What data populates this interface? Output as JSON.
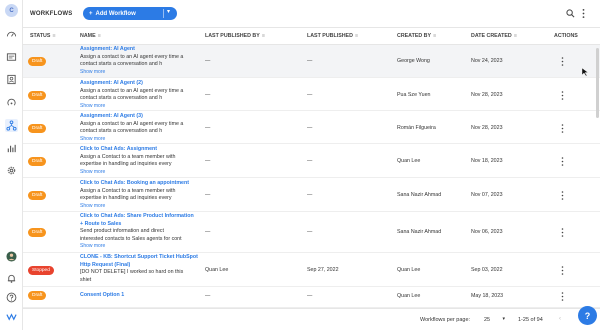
{
  "sidebar": {
    "avatar_initial": "C"
  },
  "header": {
    "title": "WORKFLOWS",
    "add_button": "Add Workflow"
  },
  "table": {
    "columns": [
      "STATUS",
      "NAME",
      "LAST PUBLISHED BY",
      "LAST PUBLISHED",
      "CREATED BY",
      "DATE CREATED",
      "ACTIONS"
    ],
    "rows": [
      {
        "status": "Draft",
        "title": "Assignment: AI Agent",
        "desc": [
          "Assign a contact to an AI agent every time a",
          "contact starts a conversation and h"
        ],
        "more": "Show more",
        "published_by": "—",
        "published": "—",
        "created_by": "George Wong",
        "date_created": "Nov 24, 2023"
      },
      {
        "status": "Draft",
        "title": "Assignment: AI Agent (2)",
        "desc": [
          "Assign a contact to an AI agent every time a",
          "contact starts a conversation and h"
        ],
        "more": "Show more",
        "published_by": "—",
        "published": "—",
        "created_by": "Pua Sze Yuen",
        "date_created": "Nov 28, 2023"
      },
      {
        "status": "Draft",
        "title": "Assignment: AI Agent (3)",
        "desc": [
          "Assign a contact to an AI agent every time a",
          "contact starts a conversation and h"
        ],
        "more": "Show more",
        "published_by": "—",
        "published": "—",
        "created_by": "Román Filgueira",
        "date_created": "Nov 28, 2023"
      },
      {
        "status": "Draft",
        "title": "Click to Chat Ads: Assignment",
        "desc": [
          "Assign a Contact to a team member with",
          "expertise in handling ad inquiries every"
        ],
        "more": "Show more",
        "published_by": "—",
        "published": "—",
        "created_by": "Quan Lee",
        "date_created": "Nov 18, 2023"
      },
      {
        "status": "Draft",
        "title": "Click to Chat Ads: Booking an appointment",
        "desc": [
          "Assign a Contact to a team member with",
          "expertise in handling ad inquiries every"
        ],
        "more": "Show more",
        "published_by": "—",
        "published": "—",
        "created_by": "Sana Nazir Ahmad",
        "date_created": "Nov 07, 2023"
      },
      {
        "status": "Draft",
        "title": "Click to Chat Ads: Share Product Information + Route to Sales",
        "desc": [
          "Send product information and direct",
          "interested contacts to Sales agents for cont"
        ],
        "more": "Show more",
        "published_by": "—",
        "published": "—",
        "created_by": "Sana Nazir Ahmad",
        "date_created": "Nov 06, 2023"
      },
      {
        "status": "Stopped",
        "title": "CLONE - KB: Shortcut Support Ticket HubSpot Http Request (Final)",
        "desc": [
          "[DO NOT DELETE] I worked so hard on this",
          "shiet"
        ],
        "more": "",
        "published_by": "Quan Lee",
        "published": "Sep 27, 2022",
        "created_by": "Quan Lee",
        "date_created": "Sep 03, 2022"
      },
      {
        "status": "Draft",
        "title": "Consent Option 1",
        "desc": [],
        "more": "",
        "published_by": "—",
        "published": "—",
        "created_by": "Quan Lee",
        "date_created": "May 18, 2023"
      }
    ]
  },
  "footer": {
    "per_page_label": "Workflows per page:",
    "per_page": "25",
    "range": "1-25 of 94"
  },
  "colors": {
    "accent": "#2c7be5",
    "draft": "#f7941d",
    "stopped": "#e8432e"
  }
}
